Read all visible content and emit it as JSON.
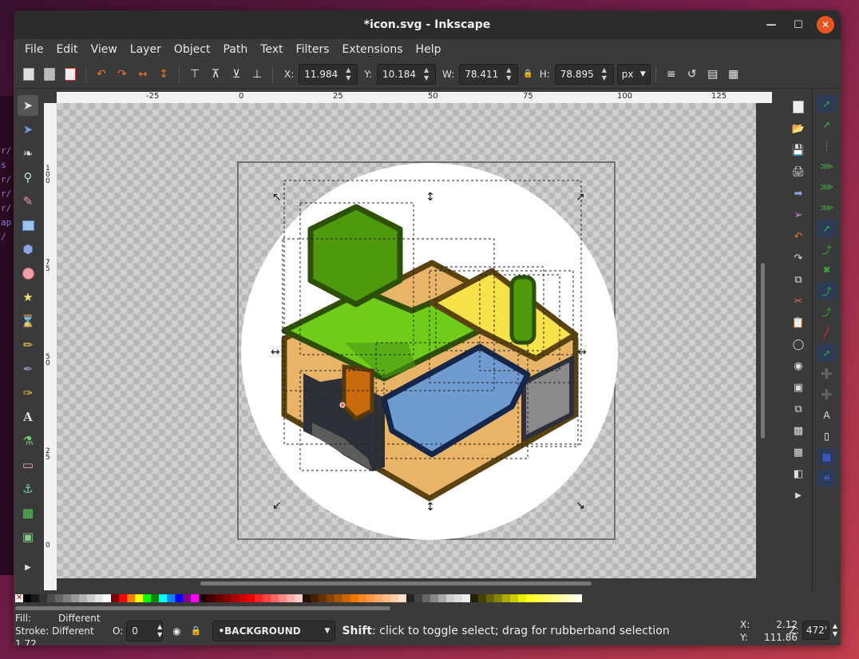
{
  "window": {
    "title": "*icon.svg - Inkscape"
  },
  "menu": [
    "File",
    "Edit",
    "View",
    "Layer",
    "Object",
    "Path",
    "Text",
    "Filters",
    "Extensions",
    "Help"
  ],
  "toolbar": {
    "x_label": "X:",
    "x_value": "11.984",
    "y_label": "Y:",
    "y_value": "10.184",
    "w_label": "W:",
    "w_value": "78.411",
    "h_label": "H:",
    "h_value": "78.895",
    "unit": "px"
  },
  "ruler": {
    "top_labels": [
      "-25",
      "0",
      "25",
      "50",
      "75",
      "100",
      "125"
    ],
    "left_labels": [
      "100",
      "75",
      "50",
      "25",
      "0"
    ]
  },
  "tools": [
    "selector-icon",
    "node-icon",
    "tweak-icon",
    "zoom-icon",
    "measure-icon",
    "rect-icon",
    "3dbox-icon",
    "ellipse-icon",
    "star-icon",
    "spiral-icon",
    "pencil-icon",
    "pen-icon",
    "calligraphy-icon",
    "text-icon",
    "spray-icon",
    "eraser-icon",
    "bucket-icon",
    "gradient-icon",
    "dropper-icon"
  ],
  "status": {
    "fill_label": "Fill:",
    "fill_value": "Different",
    "stroke_label": "Stroke:",
    "stroke_value": "Different 1.72",
    "opacity_label": "O:",
    "opacity_value": "0",
    "layer": "•BACKGROUND",
    "message_key": "Shift",
    "message_rest": ": click to toggle select; drag for rubberband selection",
    "x_label": "X:",
    "x_value": "2.12",
    "y_label": "Y:",
    "y_value": "111.86",
    "zoom_label": "Z:",
    "zoom_value": "472'"
  },
  "terminal_text": "r/\ns\nr/\nr/\nr/\nap\n/"
}
